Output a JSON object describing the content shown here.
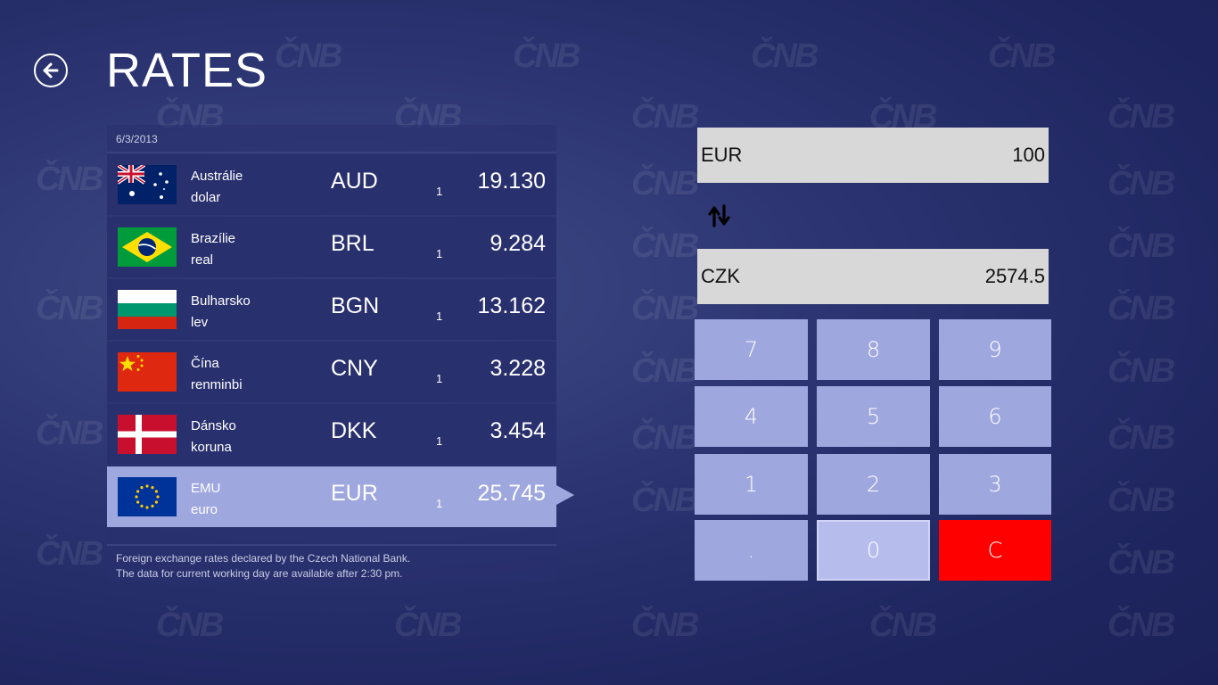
{
  "header": {
    "title": "RATES"
  },
  "watermark_text": "ČNB",
  "rates": {
    "date": "6/3/2013",
    "rows": [
      {
        "country": "Austrálie",
        "currency_name": "dolar",
        "code": "AUD",
        "amount": "1",
        "rate": "19.130",
        "flag": "flag-australia-icon"
      },
      {
        "country": "Brazílie",
        "currency_name": "real",
        "code": "BRL",
        "amount": "1",
        "rate": "9.284",
        "flag": "flag-brazil-icon"
      },
      {
        "country": "Bulharsko",
        "currency_name": "lev",
        "code": "BGN",
        "amount": "1",
        "rate": "13.162",
        "flag": "flag-bulgaria-icon"
      },
      {
        "country": "Čína",
        "currency_name": "renminbi",
        "code": "CNY",
        "amount": "1",
        "rate": "3.228",
        "flag": "flag-china-icon"
      },
      {
        "country": "Dánsko",
        "currency_name": "koruna",
        "code": "DKK",
        "amount": "1",
        "rate": "3.454",
        "flag": "flag-denmark-icon"
      },
      {
        "country": "EMU",
        "currency_name": "euro",
        "code": "EUR",
        "amount": "1",
        "rate": "25.745",
        "flag": "flag-eu-icon"
      }
    ],
    "footer": {
      "line1": "Foreign exchange rates declared by the Czech National Bank.",
      "line2": "The data for current working day are available after 2:30 pm."
    }
  },
  "converter": {
    "from": {
      "currency": "EUR",
      "value": "100"
    },
    "to": {
      "currency": "CZK",
      "value": "2574.5"
    }
  },
  "keypad": {
    "keys": [
      "7",
      "8",
      "9",
      "4",
      "5",
      "6",
      "1",
      "2",
      "3",
      ".",
      "0",
      "C"
    ]
  },
  "colors": {
    "background": "#2c3572",
    "row": "#29306e",
    "selected_row": "#9fa7df",
    "key": "#9fa7df",
    "clear_key": "#fe0000",
    "input_box": "#d8d8d8"
  }
}
